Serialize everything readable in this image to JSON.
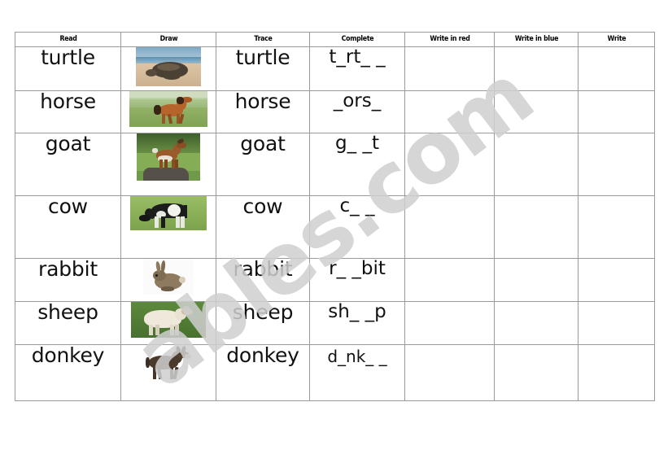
{
  "worksheet": {
    "watermark_text": "ables.com",
    "columns": [
      {
        "key": "read",
        "label": "Read"
      },
      {
        "key": "draw",
        "label": "Draw"
      },
      {
        "key": "trace",
        "label": "Trace"
      },
      {
        "key": "complete",
        "label": "Complete"
      },
      {
        "key": "write_red",
        "label": "Write in red"
      },
      {
        "key": "write_blue",
        "label": "Write in blue"
      },
      {
        "key": "write",
        "label": "Write"
      }
    ],
    "rows": [
      {
        "read": "turtle",
        "picture": "turtle-photo",
        "trace": "turtle",
        "complete": "t_rt_ _",
        "write_red": "",
        "write_blue": "",
        "write": ""
      },
      {
        "read": "horse",
        "picture": "horse-photo",
        "trace": "horse",
        "complete": "_ors_",
        "write_red": "",
        "write_blue": "",
        "write": ""
      },
      {
        "read": "goat",
        "picture": "goat-photo",
        "trace": "goat",
        "complete": "g_ _t",
        "write_red": "",
        "write_blue": "",
        "write": ""
      },
      {
        "read": "cow",
        "picture": "cow-photo",
        "trace": "cow",
        "complete": "c_ _",
        "write_red": "",
        "write_blue": "",
        "write": ""
      },
      {
        "read": "rabbit",
        "picture": "rabbit-photo",
        "trace": "rabbit",
        "complete": "r_ _bit",
        "write_red": "",
        "write_blue": "",
        "write": ""
      },
      {
        "read": "sheep",
        "picture": "sheep-photo",
        "trace": "sheep",
        "complete": "sh_ _p",
        "write_red": "",
        "write_blue": "",
        "write": ""
      },
      {
        "read": "donkey",
        "picture": "donkey-photo",
        "trace": "donkey",
        "complete": "d_nk_ _",
        "write_red": "",
        "write_blue": "",
        "write": ""
      }
    ]
  }
}
